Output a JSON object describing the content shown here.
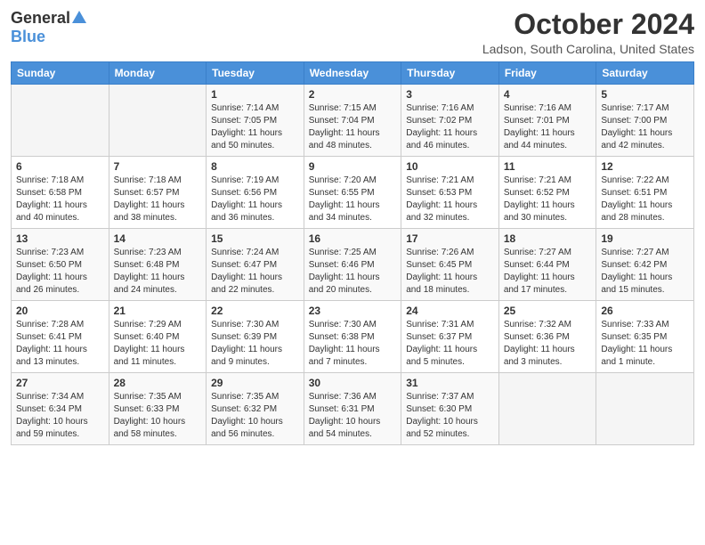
{
  "header": {
    "logo_general": "General",
    "logo_blue": "Blue",
    "month_title": "October 2024",
    "location": "Ladson, South Carolina, United States"
  },
  "days_of_week": [
    "Sunday",
    "Monday",
    "Tuesday",
    "Wednesday",
    "Thursday",
    "Friday",
    "Saturday"
  ],
  "weeks": [
    [
      {
        "day": "",
        "info": ""
      },
      {
        "day": "",
        "info": ""
      },
      {
        "day": "1",
        "info": "Sunrise: 7:14 AM\nSunset: 7:05 PM\nDaylight: 11 hours and 50 minutes."
      },
      {
        "day": "2",
        "info": "Sunrise: 7:15 AM\nSunset: 7:04 PM\nDaylight: 11 hours and 48 minutes."
      },
      {
        "day": "3",
        "info": "Sunrise: 7:16 AM\nSunset: 7:02 PM\nDaylight: 11 hours and 46 minutes."
      },
      {
        "day": "4",
        "info": "Sunrise: 7:16 AM\nSunset: 7:01 PM\nDaylight: 11 hours and 44 minutes."
      },
      {
        "day": "5",
        "info": "Sunrise: 7:17 AM\nSunset: 7:00 PM\nDaylight: 11 hours and 42 minutes."
      }
    ],
    [
      {
        "day": "6",
        "info": "Sunrise: 7:18 AM\nSunset: 6:58 PM\nDaylight: 11 hours and 40 minutes."
      },
      {
        "day": "7",
        "info": "Sunrise: 7:18 AM\nSunset: 6:57 PM\nDaylight: 11 hours and 38 minutes."
      },
      {
        "day": "8",
        "info": "Sunrise: 7:19 AM\nSunset: 6:56 PM\nDaylight: 11 hours and 36 minutes."
      },
      {
        "day": "9",
        "info": "Sunrise: 7:20 AM\nSunset: 6:55 PM\nDaylight: 11 hours and 34 minutes."
      },
      {
        "day": "10",
        "info": "Sunrise: 7:21 AM\nSunset: 6:53 PM\nDaylight: 11 hours and 32 minutes."
      },
      {
        "day": "11",
        "info": "Sunrise: 7:21 AM\nSunset: 6:52 PM\nDaylight: 11 hours and 30 minutes."
      },
      {
        "day": "12",
        "info": "Sunrise: 7:22 AM\nSunset: 6:51 PM\nDaylight: 11 hours and 28 minutes."
      }
    ],
    [
      {
        "day": "13",
        "info": "Sunrise: 7:23 AM\nSunset: 6:50 PM\nDaylight: 11 hours and 26 minutes."
      },
      {
        "day": "14",
        "info": "Sunrise: 7:23 AM\nSunset: 6:48 PM\nDaylight: 11 hours and 24 minutes."
      },
      {
        "day": "15",
        "info": "Sunrise: 7:24 AM\nSunset: 6:47 PM\nDaylight: 11 hours and 22 minutes."
      },
      {
        "day": "16",
        "info": "Sunrise: 7:25 AM\nSunset: 6:46 PM\nDaylight: 11 hours and 20 minutes."
      },
      {
        "day": "17",
        "info": "Sunrise: 7:26 AM\nSunset: 6:45 PM\nDaylight: 11 hours and 18 minutes."
      },
      {
        "day": "18",
        "info": "Sunrise: 7:27 AM\nSunset: 6:44 PM\nDaylight: 11 hours and 17 minutes."
      },
      {
        "day": "19",
        "info": "Sunrise: 7:27 AM\nSunset: 6:42 PM\nDaylight: 11 hours and 15 minutes."
      }
    ],
    [
      {
        "day": "20",
        "info": "Sunrise: 7:28 AM\nSunset: 6:41 PM\nDaylight: 11 hours and 13 minutes."
      },
      {
        "day": "21",
        "info": "Sunrise: 7:29 AM\nSunset: 6:40 PM\nDaylight: 11 hours and 11 minutes."
      },
      {
        "day": "22",
        "info": "Sunrise: 7:30 AM\nSunset: 6:39 PM\nDaylight: 11 hours and 9 minutes."
      },
      {
        "day": "23",
        "info": "Sunrise: 7:30 AM\nSunset: 6:38 PM\nDaylight: 11 hours and 7 minutes."
      },
      {
        "day": "24",
        "info": "Sunrise: 7:31 AM\nSunset: 6:37 PM\nDaylight: 11 hours and 5 minutes."
      },
      {
        "day": "25",
        "info": "Sunrise: 7:32 AM\nSunset: 6:36 PM\nDaylight: 11 hours and 3 minutes."
      },
      {
        "day": "26",
        "info": "Sunrise: 7:33 AM\nSunset: 6:35 PM\nDaylight: 11 hours and 1 minute."
      }
    ],
    [
      {
        "day": "27",
        "info": "Sunrise: 7:34 AM\nSunset: 6:34 PM\nDaylight: 10 hours and 59 minutes."
      },
      {
        "day": "28",
        "info": "Sunrise: 7:35 AM\nSunset: 6:33 PM\nDaylight: 10 hours and 58 minutes."
      },
      {
        "day": "29",
        "info": "Sunrise: 7:35 AM\nSunset: 6:32 PM\nDaylight: 10 hours and 56 minutes."
      },
      {
        "day": "30",
        "info": "Sunrise: 7:36 AM\nSunset: 6:31 PM\nDaylight: 10 hours and 54 minutes."
      },
      {
        "day": "31",
        "info": "Sunrise: 7:37 AM\nSunset: 6:30 PM\nDaylight: 10 hours and 52 minutes."
      },
      {
        "day": "",
        "info": ""
      },
      {
        "day": "",
        "info": ""
      }
    ]
  ]
}
